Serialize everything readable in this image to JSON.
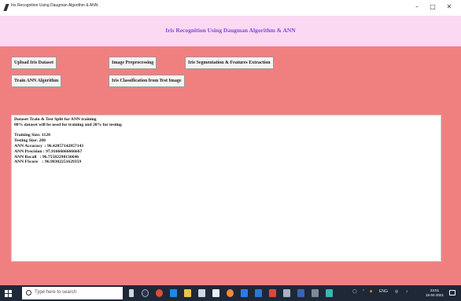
{
  "window": {
    "title": "Iris Recognition Using Daugman Algorithm & ANN",
    "minimize": "–",
    "maximize": "□",
    "close": "✕"
  },
  "heading": "Iris Recognition Using Daugman Algorithm & ANN",
  "buttons": {
    "upload": "Upload Iris Dataset",
    "preprocess": "Image Preprocessing",
    "segmentation": "Iris Segmentation & Features Extraction",
    "train": "Train ANN Algorithm",
    "classify": "Iris Classification from Test Image"
  },
  "output": {
    "header": [
      "Dataset Train & Test Split for ANN training",
      "80% dataset will be used for training and 20% for testing"
    ],
    "stats": [
      "Training Size: 1120",
      "Testing Size: 280",
      "ANN Accuracy  : 96.42857142857143",
      "ANN Precision : 97.91666666666667",
      "ANN Recall   : 96.75582298136646",
      "ANN FScore    : 96.98302251629359"
    ]
  },
  "taskbar": {
    "search_placeholder": "Type here to search",
    "time": "23:51",
    "date": "15-04-2021",
    "tray_text": "ENG",
    "icons": [
      "task-view-icon",
      "cortana-icon",
      "edge-icon",
      "file-explorer-icon",
      "store-icon",
      "mail-icon",
      "chrome-icon",
      "firefox-icon",
      "python-icon",
      "excel-icon",
      "word-icon",
      "powerpoint-icon",
      "notepad-icon",
      "terminal-icon",
      "photos-icon"
    ]
  },
  "colors": {
    "background": "#f08080",
    "heading_band": "#fbd9f2",
    "heading_text": "#7e4cd2",
    "taskbar": "#1f2836"
  }
}
